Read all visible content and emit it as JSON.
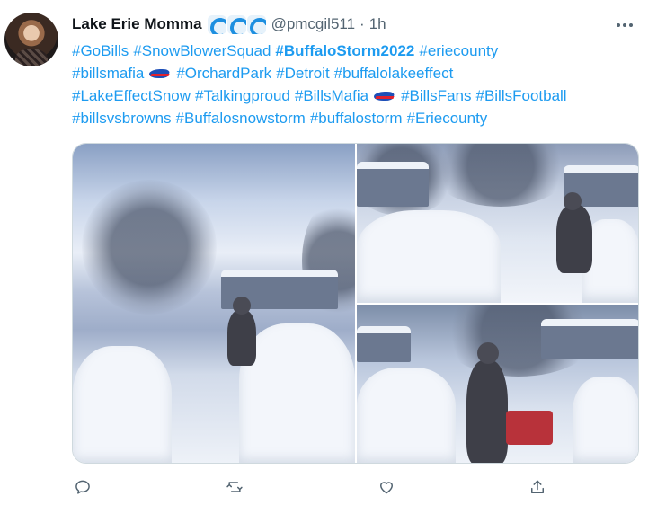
{
  "author": {
    "name": "Lake Erie Momma",
    "emoji_names": [
      "water-wave-emoji",
      "water-wave-emoji",
      "water-wave-emoji"
    ],
    "handle": "@pmcgil511",
    "separator": "·",
    "time": "1h"
  },
  "text_lines": [
    [
      {
        "t": "#GoBills"
      },
      {
        "t": "#SnowBlowerSquad"
      },
      {
        "t": "#BuffaloStorm2022",
        "bold": true
      },
      {
        "t": "#eriecounty"
      }
    ],
    [
      {
        "t": "#billsmafia"
      },
      {
        "emoji": "buffalo-bills-emoji"
      },
      {
        "t": "#OrchardPark"
      },
      {
        "t": "#Detroit"
      },
      {
        "t": "#buffalolakeeffect"
      }
    ],
    [
      {
        "t": "#LakeEffectSnow"
      },
      {
        "t": "#Talkingproud"
      },
      {
        "t": "#BillsMafia"
      },
      {
        "emoji": "buffalo-bills-emoji"
      },
      {
        "t": "#BillsFans"
      },
      {
        "t": "#BillsFootball"
      }
    ],
    [
      {
        "t": "#billsvsbrowns"
      },
      {
        "t": "#Buffalosnowstorm"
      },
      {
        "t": "#buffalostorm"
      },
      {
        "t": "#Eriecounty"
      }
    ]
  ],
  "media": {
    "images": [
      {
        "name": "snow-clearing-photo-1"
      },
      {
        "name": "snow-clearing-photo-2"
      },
      {
        "name": "snow-clearing-photo-3"
      }
    ]
  },
  "actions": [
    {
      "name": "reply-button",
      "icon": "reply-icon"
    },
    {
      "name": "retweet-button",
      "icon": "retweet-icon"
    },
    {
      "name": "like-button",
      "icon": "heart-icon"
    },
    {
      "name": "share-button",
      "icon": "share-icon"
    }
  ],
  "colors": {
    "link": "#1d9bf0",
    "text": "#0f1419",
    "secondary": "#536471",
    "border": "#cfd9de"
  }
}
